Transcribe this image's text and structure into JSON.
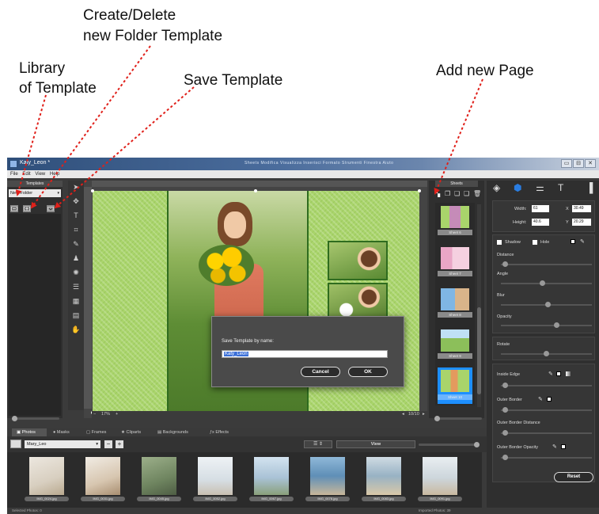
{
  "annotations": {
    "library": [
      "Library",
      "of Template"
    ],
    "create_delete": [
      "Create/Delete",
      "new Folder Template"
    ],
    "save": "Save Template",
    "add_page": "Add new Page"
  },
  "window": {
    "title": "Katy_Leon *",
    "blurred_menu": "Sheets  Modifica  Visualizza  Inserisci  Formato  Strumenti  Finestra  Aiuto",
    "minimize": "▭",
    "maximize": "⊟",
    "close": "✕"
  },
  "menu": [
    "File",
    "Edit",
    "View",
    "Help"
  ],
  "templates_panel": {
    "title": "Templates",
    "folder_value": "New Folder",
    "folder_options_caret": "▾"
  },
  "canvas": {
    "zoom": "17%",
    "page_counter": "10/10"
  },
  "dialog": {
    "label": "Save Template by name:",
    "value": "Katy_Leon",
    "cancel": "Cancel",
    "ok": "OK"
  },
  "sheets_panel": {
    "title": "Sheets",
    "sheets": [
      {
        "label": "Sheet 6"
      },
      {
        "label": "Sheet 7"
      },
      {
        "label": "Sheet 8"
      },
      {
        "label": "Sheet 9"
      },
      {
        "label": "Sheet 10",
        "active": true
      }
    ]
  },
  "properties": {
    "width_label": "Width:",
    "width_value": "61",
    "x_label": "X",
    "x_value": "30.49",
    "height_label": "Height:",
    "height_value": "40.6",
    "y_label": "Y",
    "y_value": "20.29",
    "shadow_label": "Shadow",
    "hole_label": "Hole",
    "distance_label": "Distance",
    "angle_label": "Angle",
    "blur_label": "Blur",
    "opacity_label": "Opacity",
    "rotate_label": "Rotate",
    "inside_edge_label": "Inside Edge",
    "outer_border_label": "Outer Border",
    "outer_border_distance_label": "Outer Border Distance",
    "outer_border_opacity_label": "Outer Border Opacity",
    "reset_label": "Reset",
    "sliders": {
      "distance": 0.02,
      "angle": 0.45,
      "blur": 0.52,
      "opacity": 0.62,
      "rotate": 0.5,
      "inside_edge": 0.02,
      "outer_border": 0.02,
      "outer_border_distance": 0.02,
      "outer_border_opacity": 0.02
    }
  },
  "bottom_tabs": [
    {
      "label": "Photos",
      "active": true
    },
    {
      "label": "Masks"
    },
    {
      "label": "Frames"
    },
    {
      "label": "Cliparts"
    },
    {
      "label": "Backgrounds"
    },
    {
      "label": "Effects"
    }
  ],
  "bottom_toolbar": {
    "album": "Mary_Leo",
    "view_label": "View",
    "minus": "−",
    "plus": "+"
  },
  "photos": [
    {
      "caption": "IMG_0024.jpg"
    },
    {
      "caption": "IMG_0031.jpg"
    },
    {
      "caption": "IMG_0045.jpg"
    },
    {
      "caption": "IMG_0052.jpg"
    },
    {
      "caption": "IMG_0067.jpg"
    },
    {
      "caption": "IMG_0078.jpg"
    },
    {
      "caption": "IMG_0083.jpg"
    },
    {
      "caption": "IMG_0091.jpg"
    }
  ],
  "status": {
    "left": "Selected Photos: 0",
    "right": "Imported Photos: 39"
  },
  "colors": {
    "annotation_arrow": "#e0201a",
    "accent_blue": "#1d8fff",
    "page_green": "#a9d46b"
  }
}
